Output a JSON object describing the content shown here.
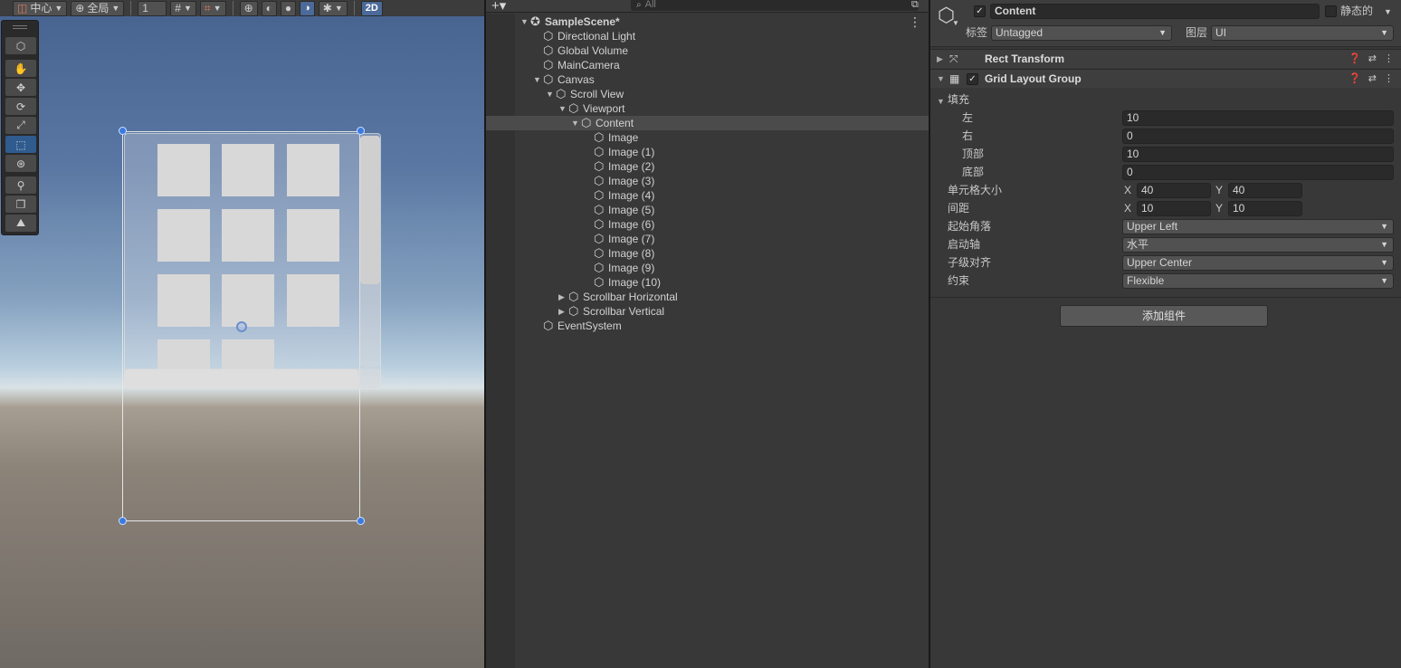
{
  "scene": {
    "toolbar": {
      "pivot_label": "中心",
      "space_label": "全局",
      "snap_value": "1",
      "mode_2d": "2D"
    }
  },
  "hierarchy": {
    "add_label": "+▾",
    "search_placeholder": "All",
    "items": [
      {
        "label": "SampleScene*",
        "depth": 0,
        "expanded": true,
        "scene": true
      },
      {
        "label": "Directional Light",
        "depth": 1
      },
      {
        "label": "Global Volume",
        "depth": 1
      },
      {
        "label": "MainCamera",
        "depth": 1
      },
      {
        "label": "Canvas",
        "depth": 1,
        "expanded": true
      },
      {
        "label": "Scroll View",
        "depth": 2,
        "expanded": true
      },
      {
        "label": "Viewport",
        "depth": 3,
        "expanded": true
      },
      {
        "label": "Content",
        "depth": 4,
        "expanded": true,
        "selected": true
      },
      {
        "label": "Image",
        "depth": 5
      },
      {
        "label": "Image (1)",
        "depth": 5
      },
      {
        "label": "Image (2)",
        "depth": 5
      },
      {
        "label": "Image (3)",
        "depth": 5
      },
      {
        "label": "Image (4)",
        "depth": 5
      },
      {
        "label": "Image (5)",
        "depth": 5
      },
      {
        "label": "Image (6)",
        "depth": 5
      },
      {
        "label": "Image (7)",
        "depth": 5
      },
      {
        "label": "Image (8)",
        "depth": 5
      },
      {
        "label": "Image (9)",
        "depth": 5
      },
      {
        "label": "Image (10)",
        "depth": 5
      },
      {
        "label": "Scrollbar Horizontal",
        "depth": 3,
        "expanded": false
      },
      {
        "label": "Scrollbar Vertical",
        "depth": 3,
        "expanded": false
      },
      {
        "label": "EventSystem",
        "depth": 1
      }
    ]
  },
  "inspector": {
    "object_name": "Content",
    "static_label": "静态的",
    "tag_label": "标签",
    "tag_value": "Untagged",
    "layer_label": "图层",
    "layer_value": "UI",
    "components": [
      {
        "title": "Rect Transform"
      },
      {
        "title": "Grid Layout Group"
      }
    ],
    "grid": {
      "padding_label": "填充",
      "left_label": "左",
      "left_value": "10",
      "right_label": "右",
      "right_value": "0",
      "top_label": "顶部",
      "top_value": "10",
      "bottom_label": "底部",
      "bottom_value": "0",
      "cell_size_label": "单元格大小",
      "cell_x": "40",
      "cell_y": "40",
      "spacing_label": "间距",
      "spacing_x": "10",
      "spacing_y": "10",
      "x_label": "X",
      "y_label": "Y",
      "start_corner_label": "起始角落",
      "start_corner_value": "Upper Left",
      "start_axis_label": "启动轴",
      "start_axis_value": "水平",
      "child_align_label": "子级对齐",
      "child_align_value": "Upper Center",
      "constraint_label": "约束",
      "constraint_value": "Flexible"
    },
    "add_component_label": "添加组件"
  }
}
